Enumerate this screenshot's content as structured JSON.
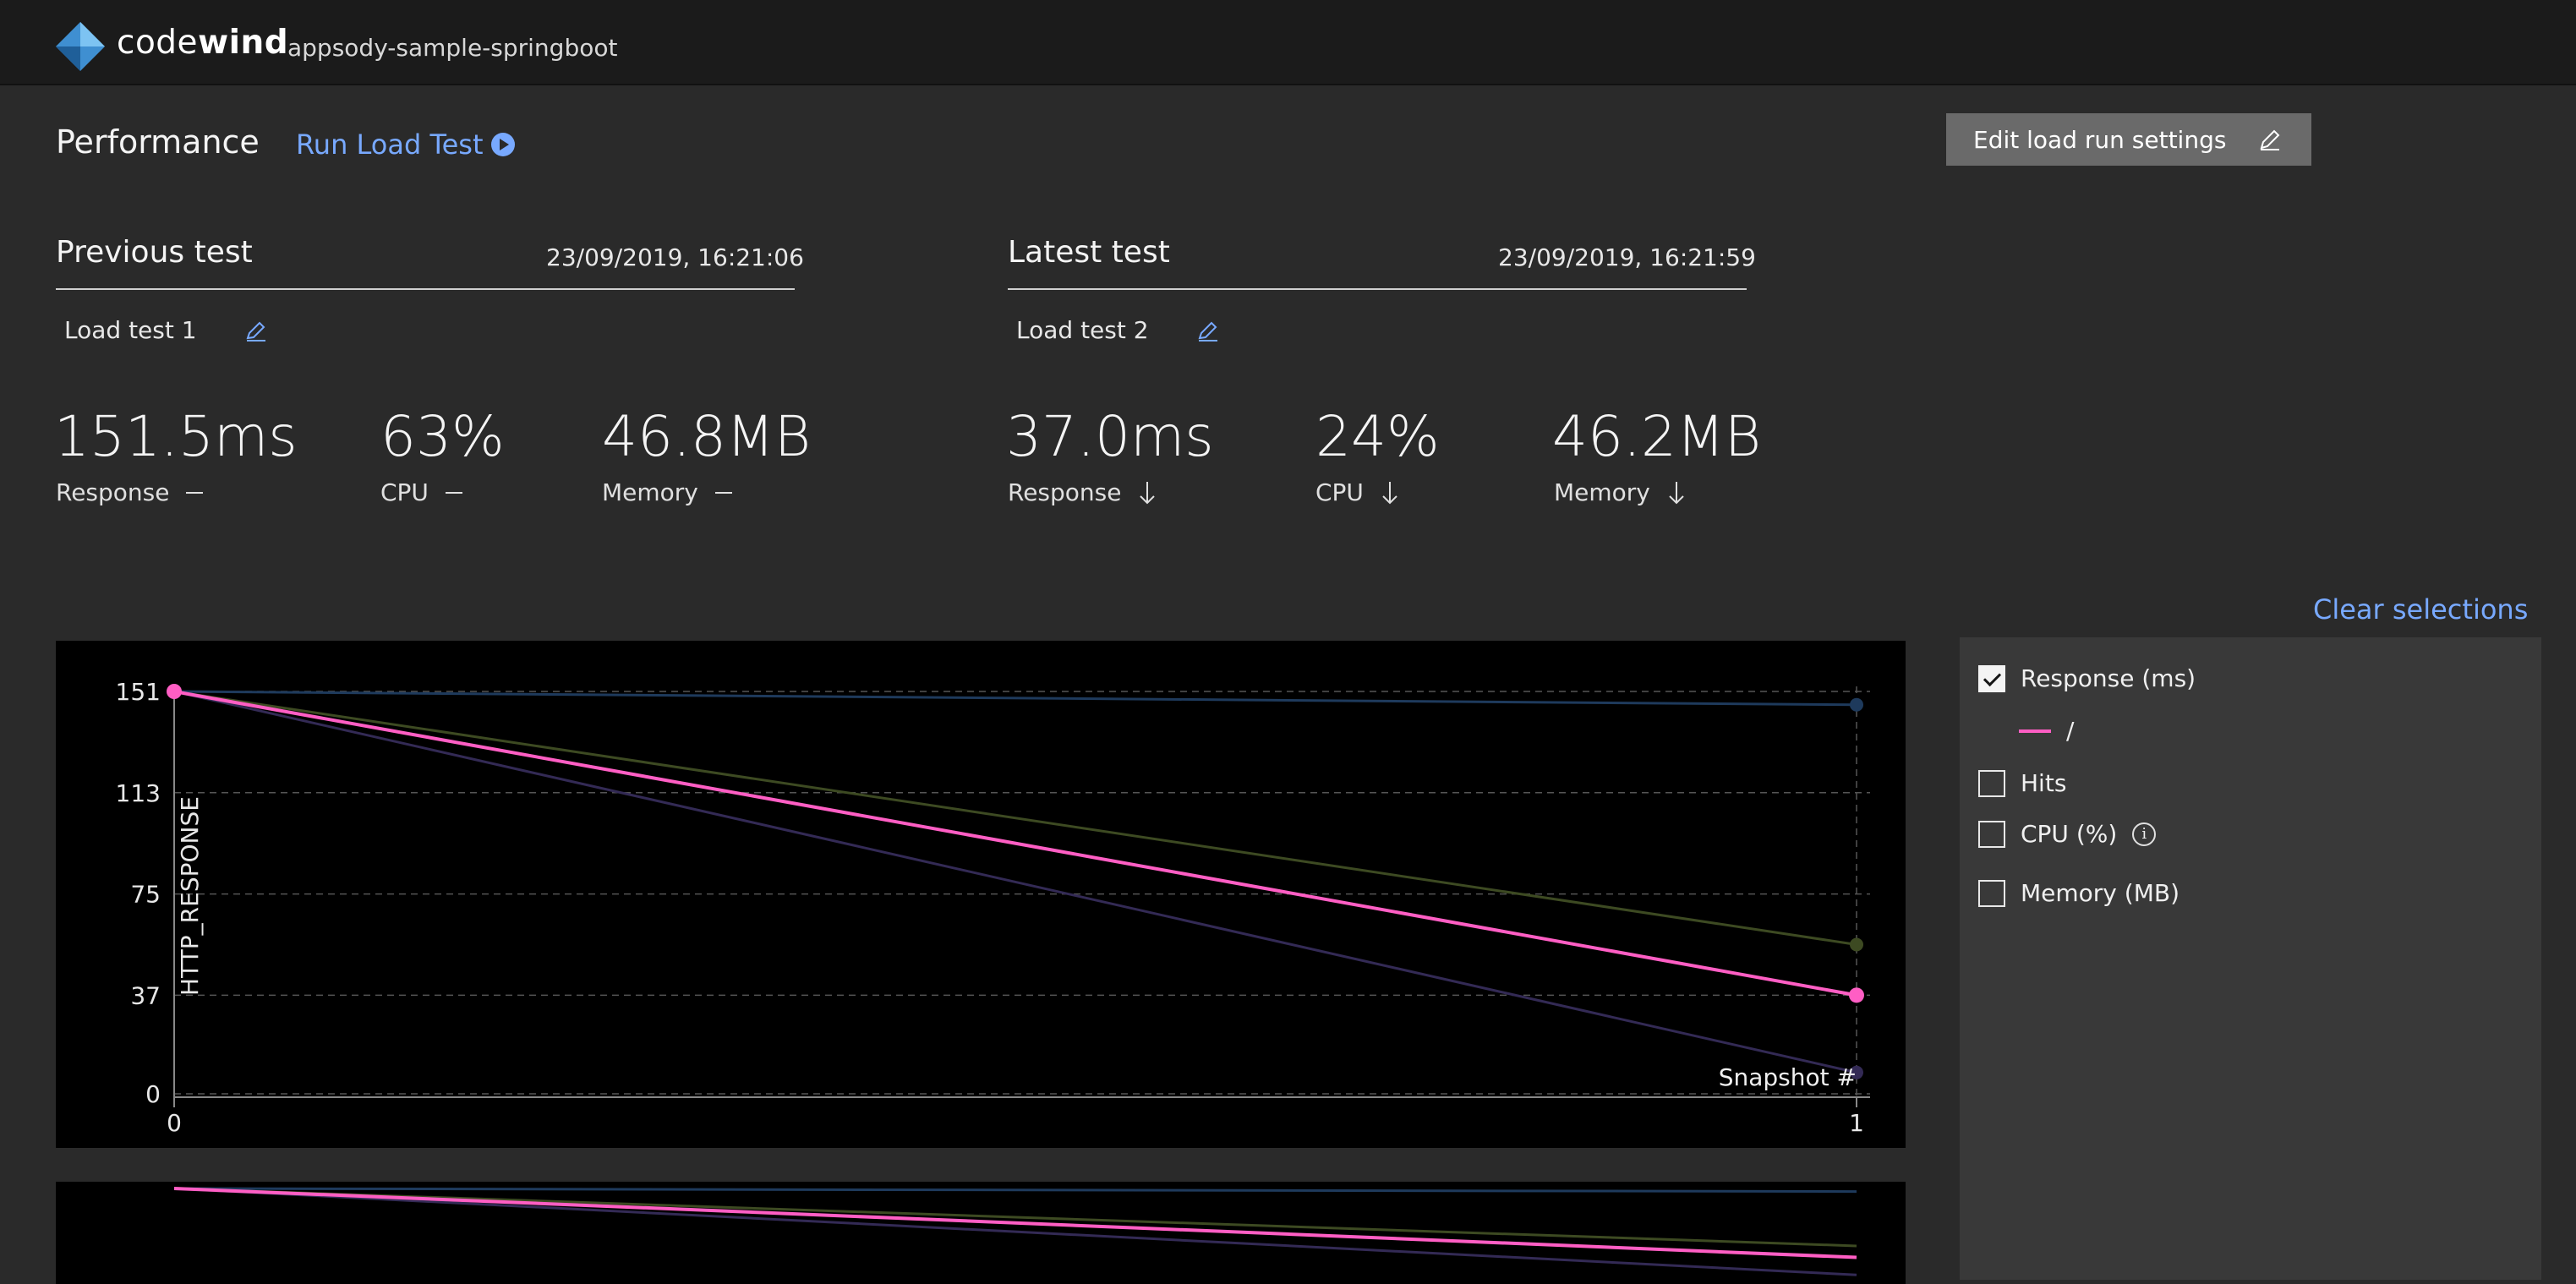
{
  "header": {
    "brand_prefix": "code",
    "brand_suffix": "wind",
    "project_name": "appsody-sample-springboot"
  },
  "page": {
    "title": "Performance",
    "run_load_test": "Run Load Test",
    "edit_settings": "Edit load run settings",
    "clear_selections": "Clear selections"
  },
  "previous": {
    "heading": "Previous test",
    "date": "23/09/2019, 16:21:06",
    "name": "Load test 1",
    "response_value": "151.5ms",
    "response_label": "Response",
    "cpu_value": "63%",
    "cpu_label": "CPU",
    "memory_value": "46.8MB",
    "memory_label": "Memory",
    "trend": "none"
  },
  "latest": {
    "heading": "Latest test",
    "date": "23/09/2019, 16:21:59",
    "name": "Load test 2",
    "response_value": "37.0ms",
    "response_label": "Response",
    "cpu_value": "24%",
    "cpu_label": "CPU",
    "memory_value": "46.2MB",
    "memory_label": "Memory",
    "trend": "down"
  },
  "legend_panel": {
    "items": [
      {
        "label": "Response (ms)",
        "checked": true
      },
      {
        "label": "Hits",
        "checked": false
      },
      {
        "label": "CPU (%)",
        "checked": false
      },
      {
        "label": "Memory (MB)",
        "checked": false
      }
    ],
    "series_label": "/",
    "series_color": "#ff5ec4"
  },
  "chart_data": {
    "type": "line",
    "ylabel": "HTTP_RESPONSE",
    "xlabel": "Snapshot #",
    "x": [
      0,
      1
    ],
    "y_ticks": [
      0,
      37,
      75,
      113,
      151
    ],
    "ylim": [
      0,
      151
    ],
    "xlim": [
      0,
      1
    ],
    "grid": true,
    "series": [
      {
        "values": [
          151,
          37
        ],
        "color": "#ff5ec4",
        "highlighted": true
      },
      {
        "values": [
          151,
          56
        ],
        "color": "#3d4a22"
      },
      {
        "values": [
          151,
          146
        ],
        "color": "#1e3a5c"
      },
      {
        "values": [
          151,
          8
        ],
        "color": "#332a55"
      }
    ]
  }
}
